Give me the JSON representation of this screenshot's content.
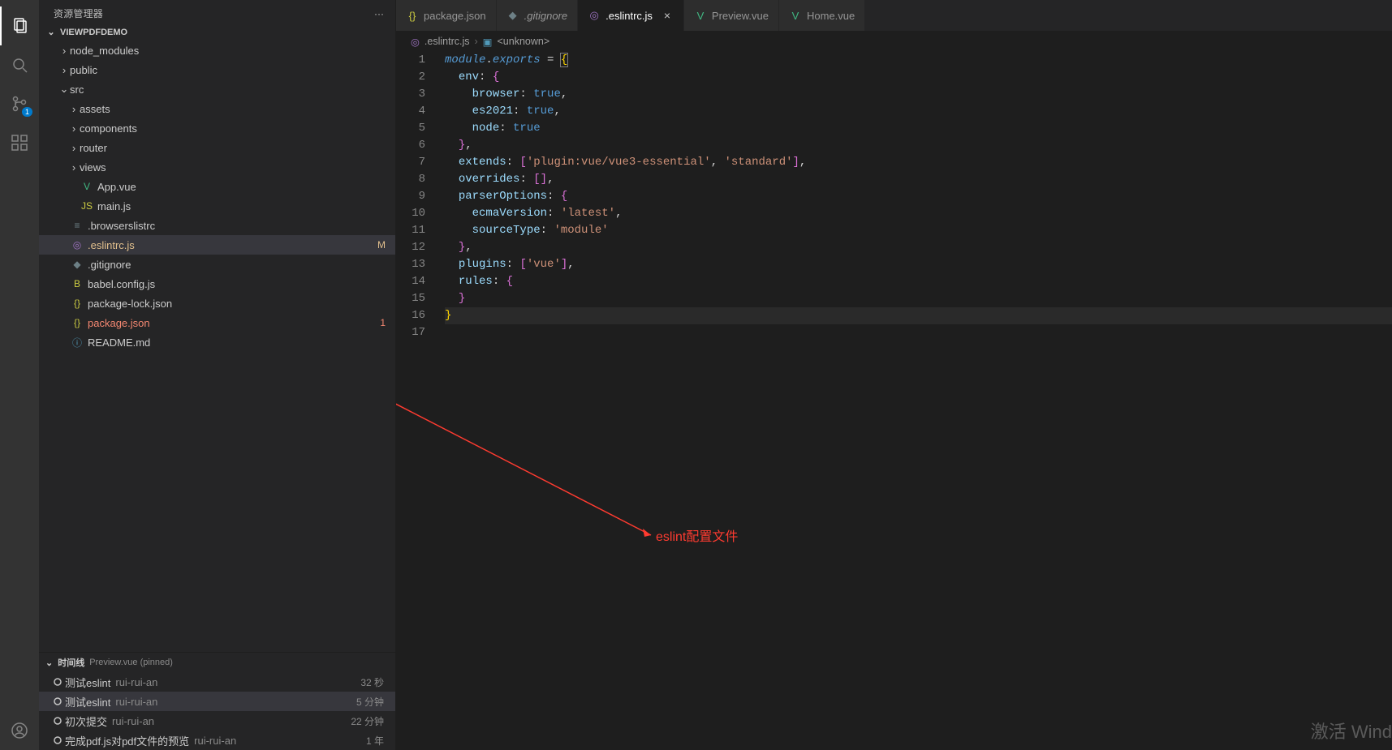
{
  "sidebar": {
    "title": "资源管理器",
    "project": "VIEWPDFDEMO",
    "tree": [
      {
        "type": "folder",
        "label": "node_modules",
        "expanded": false,
        "indent": 1
      },
      {
        "type": "folder",
        "label": "public",
        "expanded": false,
        "indent": 1
      },
      {
        "type": "folder",
        "label": "src",
        "expanded": true,
        "indent": 1
      },
      {
        "type": "folder",
        "label": "assets",
        "expanded": false,
        "indent": 2
      },
      {
        "type": "folder",
        "label": "components",
        "expanded": false,
        "indent": 2
      },
      {
        "type": "folder",
        "label": "router",
        "expanded": false,
        "indent": 2
      },
      {
        "type": "folder",
        "label": "views",
        "expanded": false,
        "indent": 2
      },
      {
        "type": "file",
        "label": "App.vue",
        "iconText": "V",
        "iconClass": "green",
        "indent": 2
      },
      {
        "type": "file",
        "label": "main.js",
        "iconText": "JS",
        "iconClass": "yellow",
        "indent": 2
      },
      {
        "type": "file",
        "label": ".browserslistrc",
        "iconText": "≡",
        "iconClass": "gray",
        "indent": 1
      },
      {
        "type": "file",
        "label": ".eslintrc.js",
        "iconText": "◎",
        "iconClass": "purple",
        "indent": 1,
        "selected": true,
        "git": "mod",
        "decor": "M"
      },
      {
        "type": "file",
        "label": ".gitignore",
        "iconText": "◆",
        "iconClass": "gray",
        "indent": 1
      },
      {
        "type": "file",
        "label": "babel.config.js",
        "iconText": "B",
        "iconClass": "yellow",
        "indent": 1
      },
      {
        "type": "file",
        "label": "package-lock.json",
        "iconText": "{}",
        "iconClass": "yellow",
        "indent": 1
      },
      {
        "type": "file",
        "label": "package.json",
        "iconText": "{}",
        "iconClass": "yellow",
        "indent": 1,
        "git": "err",
        "decor": "1"
      },
      {
        "type": "file",
        "label": "README.md",
        "iconText": "ⓘ",
        "iconClass": "blue",
        "indent": 1
      }
    ],
    "timeline": {
      "title": "时间线",
      "sub": "Preview.vue (pinned)",
      "items": [
        {
          "msg": "测试eslint",
          "author": "rui-rui-an",
          "time": "32 秒"
        },
        {
          "msg": "测试eslint",
          "author": "rui-rui-an",
          "time": "5 分钟",
          "selected": true
        },
        {
          "msg": "初次提交",
          "author": "rui-rui-an",
          "time": "22 分钟"
        },
        {
          "msg": "完成pdf.js对pdf文件的预览",
          "author": "rui-rui-an",
          "time": "1 年"
        }
      ]
    }
  },
  "activitybar": {
    "scm_badge": "1"
  },
  "tabs": [
    {
      "label": "package.json",
      "iconText": "{}",
      "iconClass": "yellow"
    },
    {
      "label": ".gitignore",
      "iconText": "◆",
      "iconClass": "gray",
      "italic": true
    },
    {
      "label": ".eslintrc.js",
      "iconText": "◎",
      "iconClass": "purple",
      "active": true,
      "close": true
    },
    {
      "label": "Preview.vue",
      "iconText": "V",
      "iconClass": "green"
    },
    {
      "label": "Home.vue",
      "iconText": "V",
      "iconClass": "green"
    }
  ],
  "breadcrumbs": {
    "file": ".eslintrc.js",
    "symbol": "<unknown>"
  },
  "code": {
    "lines": [
      [
        {
          "t": "module",
          "c": "tok-kw"
        },
        {
          "t": ".",
          "c": "tok-punc"
        },
        {
          "t": "exports",
          "c": "tok-kw"
        },
        {
          "t": " = ",
          "c": "tok-punc"
        },
        {
          "t": "{",
          "c": "tok-brace cursor-box"
        }
      ],
      [
        {
          "t": "  ",
          "c": ""
        },
        {
          "t": "env",
          "c": "tok-prop"
        },
        {
          "t": ": ",
          "c": "tok-punc"
        },
        {
          "t": "{",
          "c": "tok-brace2"
        }
      ],
      [
        {
          "t": "    ",
          "c": ""
        },
        {
          "t": "browser",
          "c": "tok-prop"
        },
        {
          "t": ": ",
          "c": "tok-punc"
        },
        {
          "t": "true",
          "c": "tok-const"
        },
        {
          "t": ",",
          "c": "tok-punc"
        }
      ],
      [
        {
          "t": "    ",
          "c": ""
        },
        {
          "t": "es2021",
          "c": "tok-prop"
        },
        {
          "t": ": ",
          "c": "tok-punc"
        },
        {
          "t": "true",
          "c": "tok-const"
        },
        {
          "t": ",",
          "c": "tok-punc"
        }
      ],
      [
        {
          "t": "    ",
          "c": ""
        },
        {
          "t": "node",
          "c": "tok-prop"
        },
        {
          "t": ": ",
          "c": "tok-punc"
        },
        {
          "t": "true",
          "c": "tok-const"
        }
      ],
      [
        {
          "t": "  ",
          "c": ""
        },
        {
          "t": "}",
          "c": "tok-brace2"
        },
        {
          "t": ",",
          "c": "tok-punc"
        }
      ],
      [
        {
          "t": "  ",
          "c": ""
        },
        {
          "t": "extends",
          "c": "tok-prop"
        },
        {
          "t": ": ",
          "c": "tok-punc"
        },
        {
          "t": "[",
          "c": "tok-brace2"
        },
        {
          "t": "'plugin:vue/vue3-essential'",
          "c": "tok-str"
        },
        {
          "t": ", ",
          "c": "tok-punc"
        },
        {
          "t": "'standard'",
          "c": "tok-str"
        },
        {
          "t": "]",
          "c": "tok-brace2"
        },
        {
          "t": ",",
          "c": "tok-punc"
        }
      ],
      [
        {
          "t": "  ",
          "c": ""
        },
        {
          "t": "overrides",
          "c": "tok-prop"
        },
        {
          "t": ": ",
          "c": "tok-punc"
        },
        {
          "t": "[",
          "c": "tok-brace2"
        },
        {
          "t": "]",
          "c": "tok-brace2"
        },
        {
          "t": ",",
          "c": "tok-punc"
        }
      ],
      [
        {
          "t": "  ",
          "c": ""
        },
        {
          "t": "parserOptions",
          "c": "tok-prop"
        },
        {
          "t": ": ",
          "c": "tok-punc"
        },
        {
          "t": "{",
          "c": "tok-brace2"
        }
      ],
      [
        {
          "t": "    ",
          "c": ""
        },
        {
          "t": "ecmaVersion",
          "c": "tok-prop"
        },
        {
          "t": ": ",
          "c": "tok-punc"
        },
        {
          "t": "'latest'",
          "c": "tok-str"
        },
        {
          "t": ",",
          "c": "tok-punc"
        }
      ],
      [
        {
          "t": "    ",
          "c": ""
        },
        {
          "t": "sourceType",
          "c": "tok-prop"
        },
        {
          "t": ": ",
          "c": "tok-punc"
        },
        {
          "t": "'module'",
          "c": "tok-str"
        }
      ],
      [
        {
          "t": "  ",
          "c": ""
        },
        {
          "t": "}",
          "c": "tok-brace2"
        },
        {
          "t": ",",
          "c": "tok-punc"
        }
      ],
      [
        {
          "t": "  ",
          "c": ""
        },
        {
          "t": "plugins",
          "c": "tok-prop"
        },
        {
          "t": ": ",
          "c": "tok-punc"
        },
        {
          "t": "[",
          "c": "tok-brace2"
        },
        {
          "t": "'vue'",
          "c": "tok-str"
        },
        {
          "t": "]",
          "c": "tok-brace2"
        },
        {
          "t": ",",
          "c": "tok-punc"
        }
      ],
      [
        {
          "t": "  ",
          "c": ""
        },
        {
          "t": "rules",
          "c": "tok-prop"
        },
        {
          "t": ": ",
          "c": "tok-punc"
        },
        {
          "t": "{",
          "c": "tok-brace2"
        }
      ],
      [
        {
          "t": "  ",
          "c": ""
        },
        {
          "t": "}",
          "c": "tok-brace2"
        }
      ],
      [
        {
          "t": "}",
          "c": "tok-brace"
        }
      ],
      [
        {
          "t": "",
          "c": ""
        }
      ]
    ]
  },
  "annotation": {
    "text": "eslint配置文件"
  },
  "watermark": "激活 Wind"
}
